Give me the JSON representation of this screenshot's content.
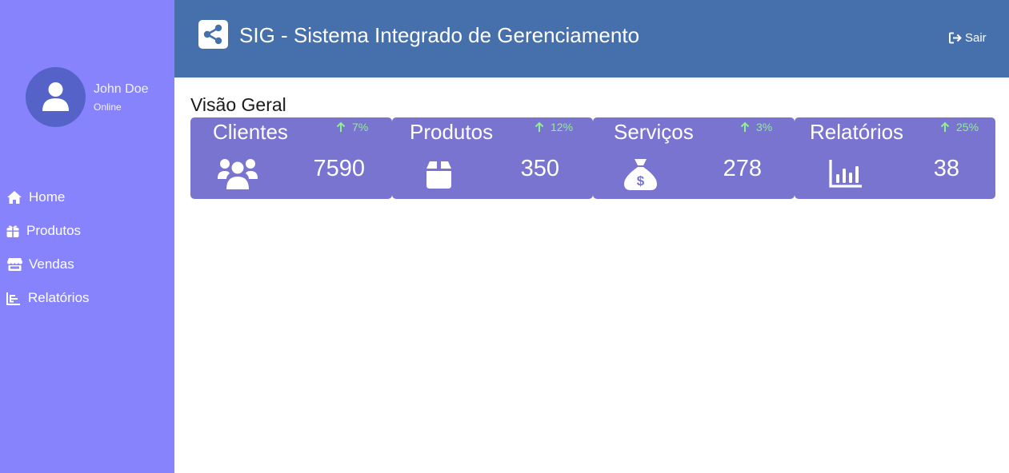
{
  "user": {
    "name": "John Doe",
    "status": "Online",
    "icon": "user-icon"
  },
  "sidebar": {
    "items": [
      {
        "label": "Home",
        "icon": "home-icon"
      },
      {
        "label": "Produtos",
        "icon": "gift-icon"
      },
      {
        "label": "Vendas",
        "icon": "store-icon"
      },
      {
        "label": "Relatórios",
        "icon": "chart-icon"
      }
    ]
  },
  "header": {
    "title": "SIG - Sistema Integrado de Gerenciamento",
    "logout_label": "Sair",
    "logo_icon": "share-icon"
  },
  "main": {
    "section_title": "Visão Geral",
    "cards": [
      {
        "title": "Clientes",
        "trend": "7%",
        "value": "7590",
        "icon": "users-icon"
      },
      {
        "title": "Produtos",
        "trend": "12%",
        "value": "350",
        "icon": "box-icon"
      },
      {
        "title": "Serviços",
        "trend": "3%",
        "value": "278",
        "icon": "money-bag-icon"
      },
      {
        "title": "Relatórios",
        "trend": "25%",
        "value": "38",
        "icon": "bar-chart-icon"
      }
    ]
  },
  "colors": {
    "sidebar_bg": "#8683fd",
    "header_bg": "#4570ab",
    "card_bg": "#7874d0",
    "avatar_bg": "#5563c9",
    "trend_up": "#90f090"
  }
}
